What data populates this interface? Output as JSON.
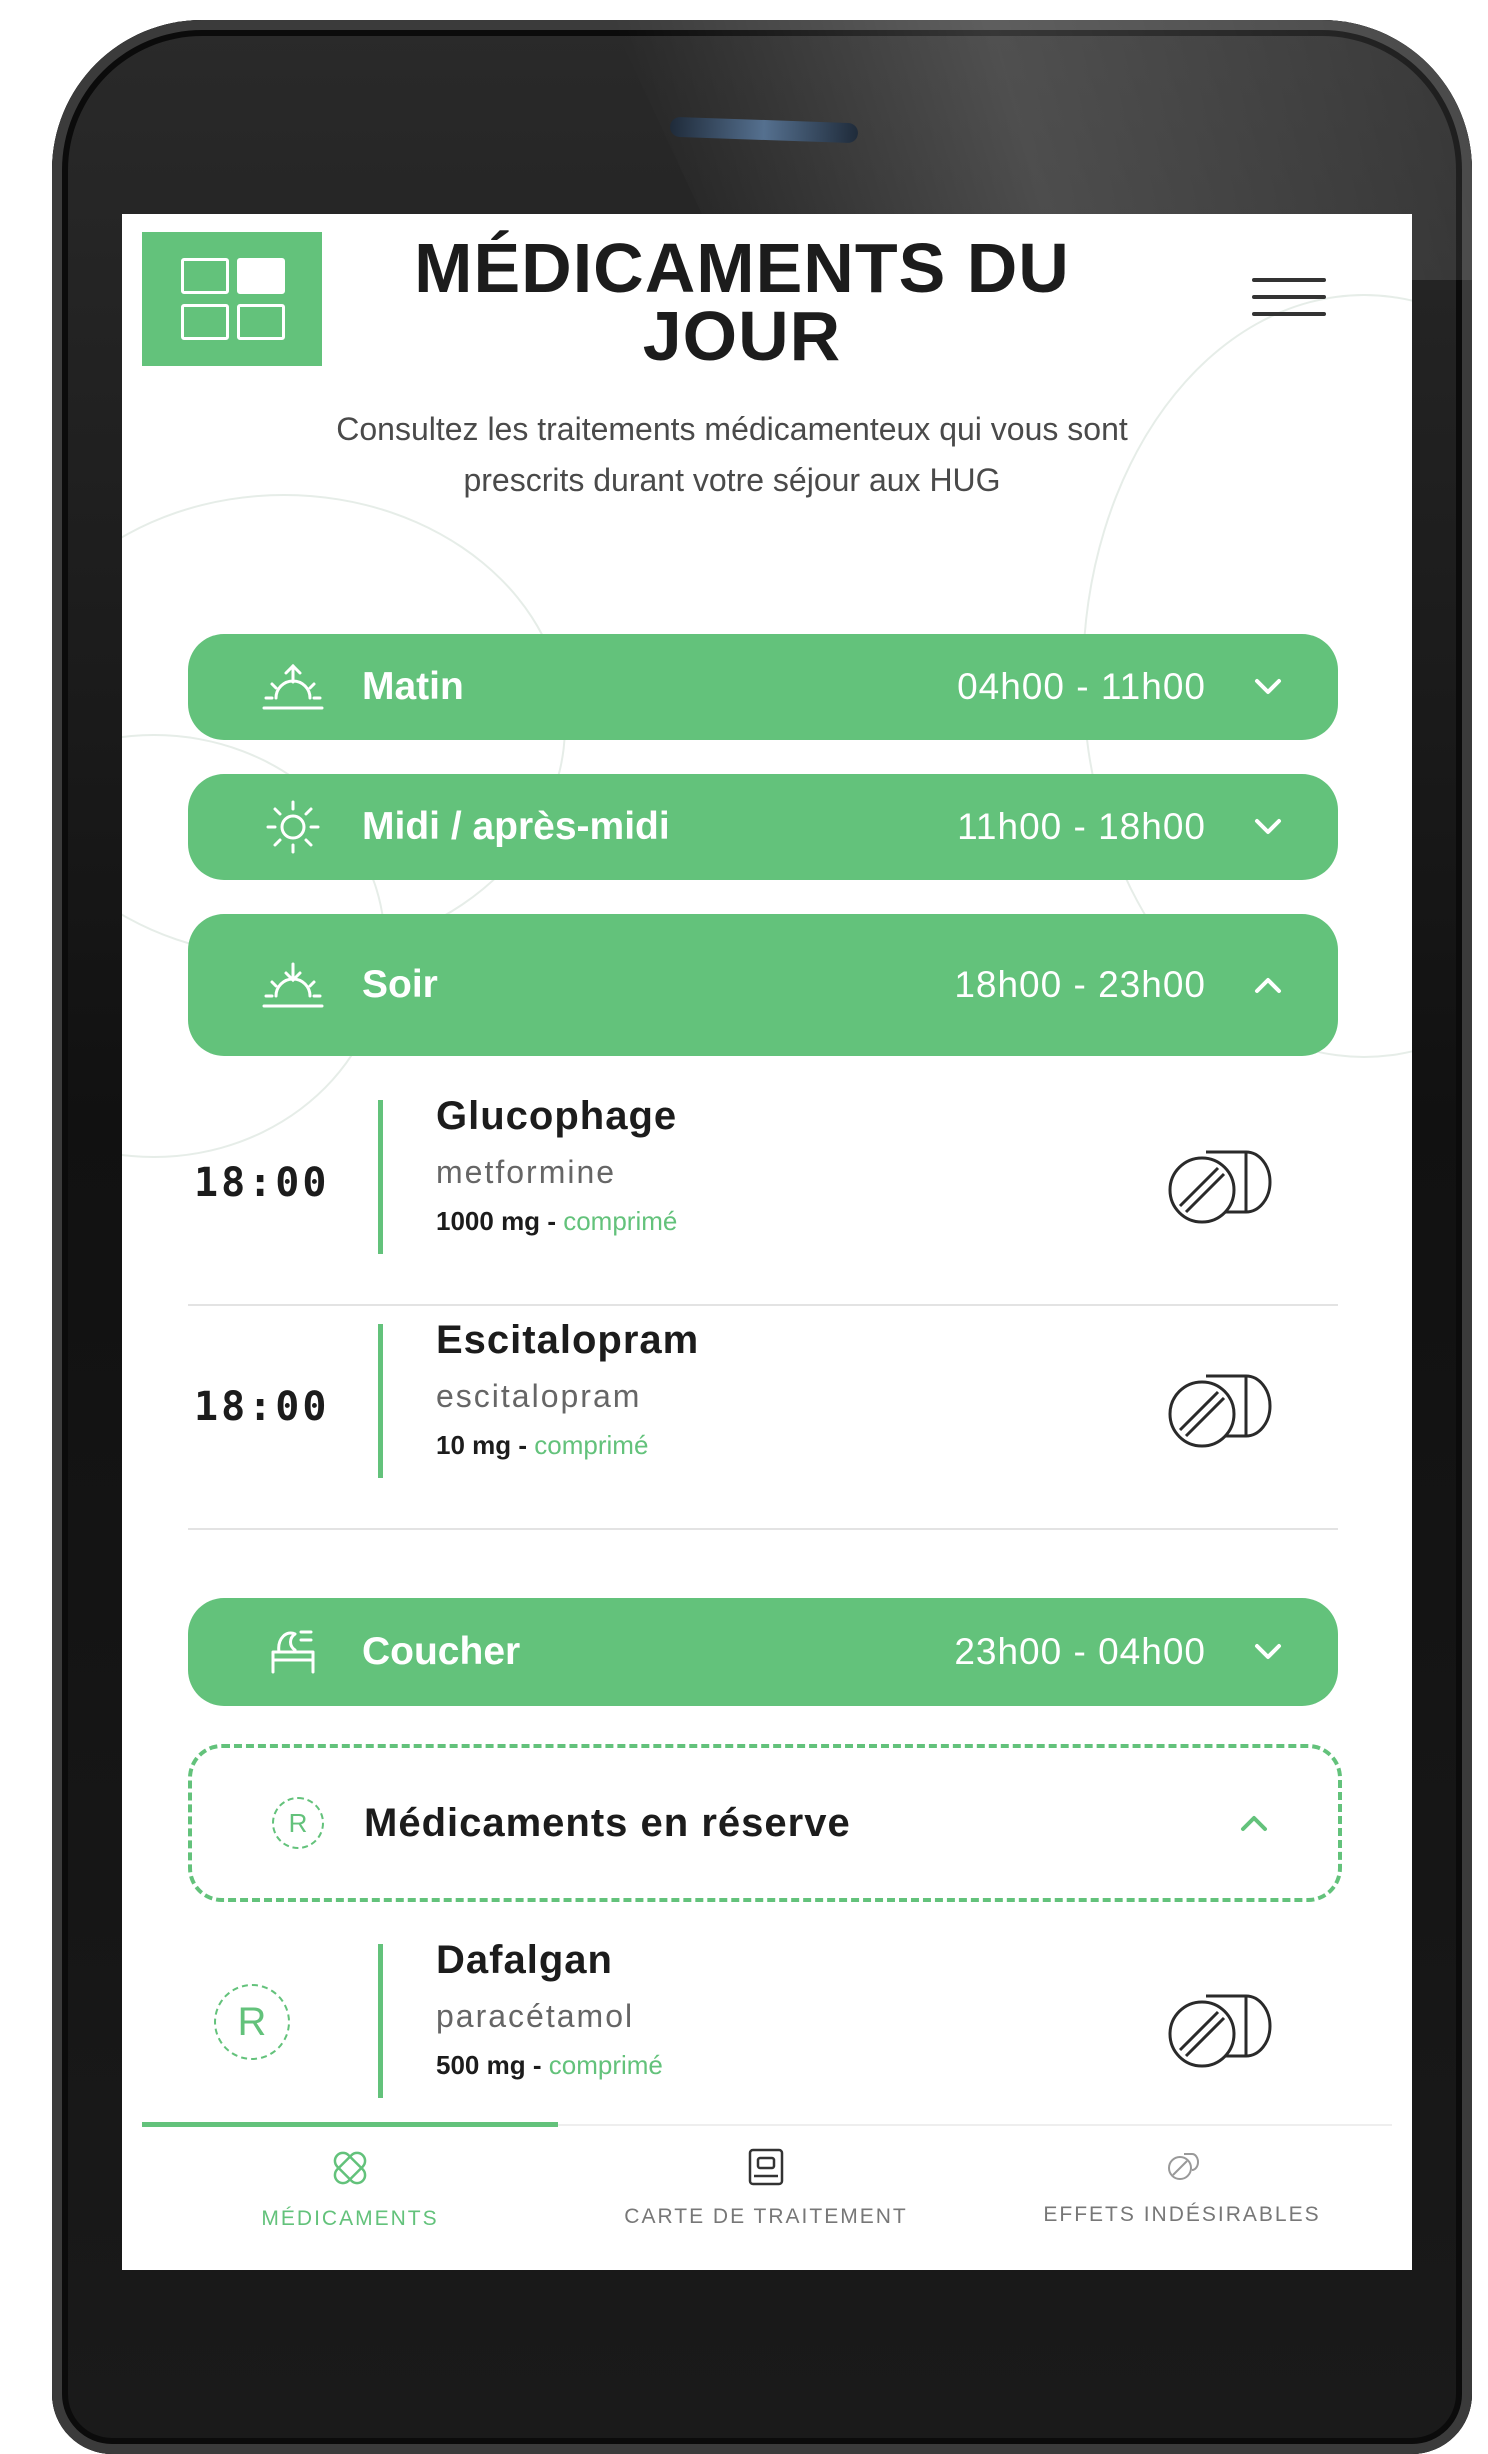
{
  "header": {
    "title": "MÉDICAMENTS DU JOUR",
    "subtitle": "Consultez les traitements médicamenteux qui vous sont prescrits durant votre séjour aux HUG"
  },
  "periods": [
    {
      "name": "Matin",
      "time": "04h00 - 11h00",
      "icon": "sunrise-icon",
      "expanded": false
    },
    {
      "name": "Midi / après-midi",
      "time": "11h00 - 18h00",
      "icon": "sun-icon",
      "expanded": false
    },
    {
      "name": "Soir",
      "time": "18h00 - 23h00",
      "icon": "sunset-icon",
      "expanded": true
    },
    {
      "name": "Coucher",
      "time": "23h00 - 04h00",
      "icon": "bed-icon",
      "expanded": false
    }
  ],
  "soir_meds": [
    {
      "time": "18:00",
      "brand": "Glucophage",
      "generic": "metformine",
      "dose": "1000 mg",
      "form": "comprimé"
    },
    {
      "time": "18:00",
      "brand": "Escitalopram",
      "generic": "escitalopram",
      "dose": "10 mg",
      "form": "comprimé"
    }
  ],
  "reserve": {
    "badge": "R",
    "title": "Médicaments en réserve",
    "meds": [
      {
        "badge": "R",
        "brand": "Dafalgan",
        "generic": "paracétamol",
        "dose": "500 mg",
        "form": "comprimé"
      }
    ]
  },
  "dose_separator": "-",
  "tabs": [
    {
      "label": "MÉDICAMENTS",
      "icon": "pills-icon",
      "active": true
    },
    {
      "label": "CARTE DE TRAITEMENT",
      "icon": "card-icon",
      "active": false
    },
    {
      "label": "EFFETS INDÉSIRABLES",
      "icon": "side-effects-icon",
      "active": false
    }
  ],
  "colors": {
    "accent": "#63c27b",
    "text": "#1c1c1c"
  }
}
